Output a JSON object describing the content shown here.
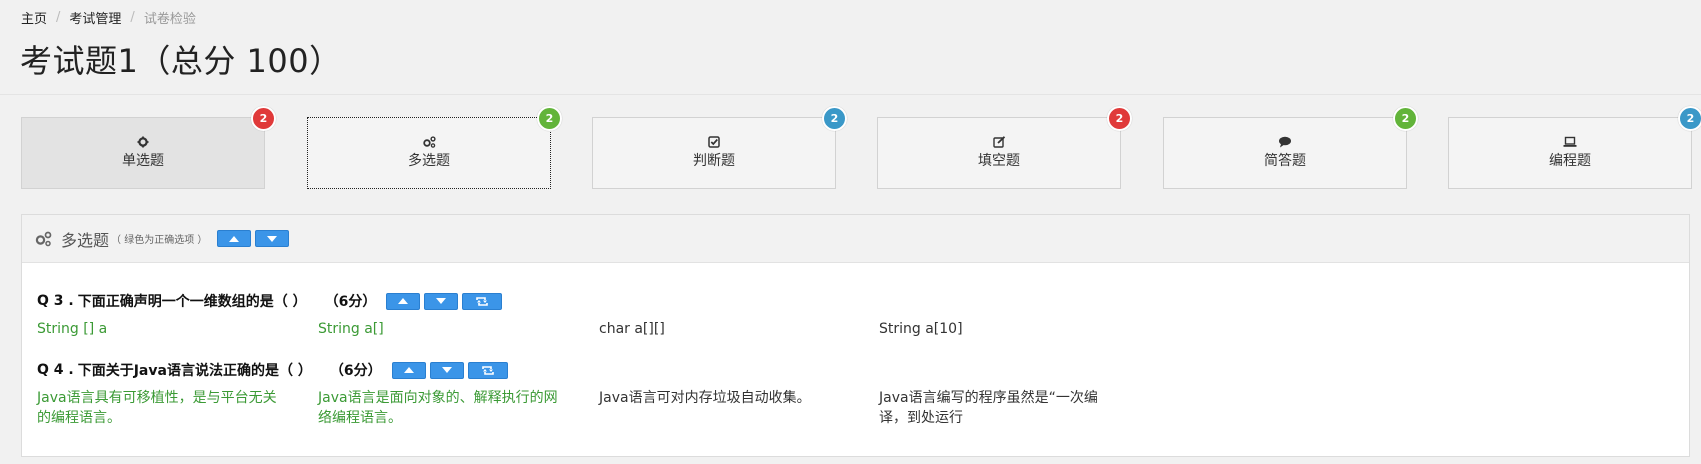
{
  "breadcrumb": {
    "home": "主页",
    "exam_mgmt": "考试管理",
    "current": "试卷检验"
  },
  "page_title": "考试题1（总分 100）",
  "type_cards": [
    {
      "label": "单选题",
      "count": "2",
      "icon": "cog-icon",
      "badge_color": "#e03a3a",
      "state": "selected"
    },
    {
      "label": "多选题",
      "count": "2",
      "icon": "cogs-icon",
      "badge_color": "#62b43a",
      "state": "focused"
    },
    {
      "label": "判断题",
      "count": "2",
      "icon": "check-square-icon",
      "badge_color": "#3a98c8",
      "state": "normal"
    },
    {
      "label": "填空题",
      "count": "2",
      "icon": "edit-icon",
      "badge_color": "#e03a3a",
      "state": "normal"
    },
    {
      "label": "简答题",
      "count": "2",
      "icon": "comment-icon",
      "badge_color": "#62b43a",
      "state": "normal"
    },
    {
      "label": "编程题",
      "count": "2",
      "icon": "laptop-icon",
      "badge_color": "#3a98c8",
      "state": "normal"
    }
  ],
  "panel": {
    "title": "多选题",
    "note": "（ 绿色为正确选项 ）"
  },
  "questions": [
    {
      "number": "Q 3 .",
      "text": "下面正确声明一个一维数组的是（  ）",
      "score": "（6分）",
      "options": [
        {
          "text": "String [] a",
          "correct": true
        },
        {
          "text": "String a[]",
          "correct": true
        },
        {
          "text": "char a[][]",
          "correct": false
        },
        {
          "text": "String a[10]",
          "correct": false
        }
      ]
    },
    {
      "number": "Q 4 .",
      "text": "下面关于Java语言说法正确的是（  ）",
      "score": "（6分）",
      "options": [
        {
          "text": "Java语言具有可移植性，是与平台无关的编程语言。",
          "correct": true
        },
        {
          "text": "Java语言是面向对象的、解释执行的网络编程语言。",
          "correct": true
        },
        {
          "text": "Java语言可对内存垃圾自动收集。",
          "correct": false
        },
        {
          "text": "Java语言编写的程序虽然是“一次编译，到处运行",
          "correct": false
        }
      ]
    }
  ],
  "colors": {
    "correct": "#3b9a35",
    "button": "#3b95e8"
  }
}
